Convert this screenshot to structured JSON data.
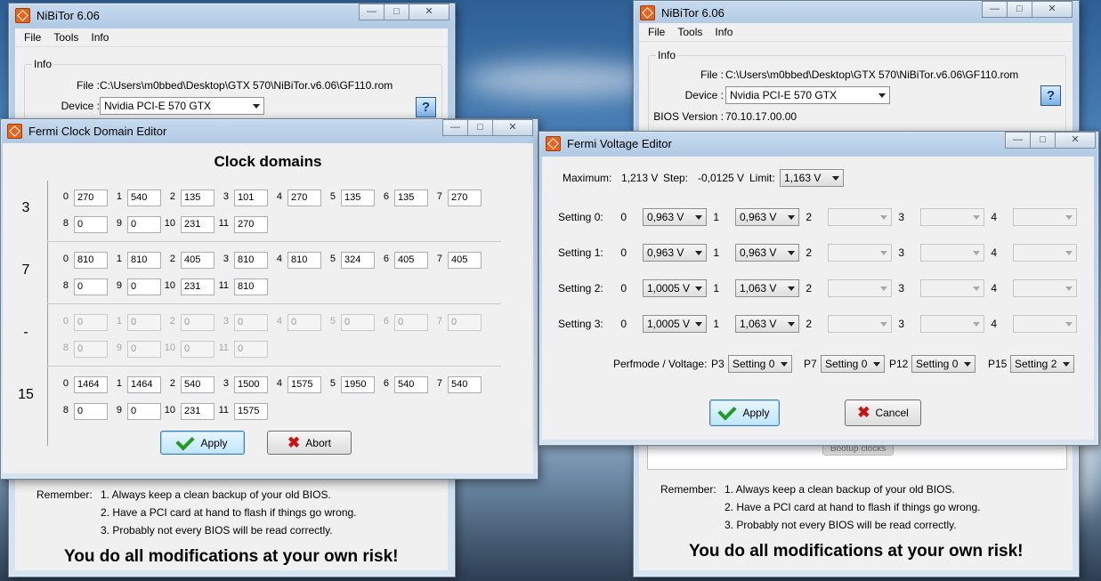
{
  "win1": {
    "title": "NiBiTor 6.06"
  },
  "win2": {
    "title": "NiBiTor 6.06"
  },
  "menu": [
    "File",
    "Tools",
    "Info"
  ],
  "info": {
    "group_title": "Info",
    "file_label": "File :",
    "file_path": "C:\\Users\\m0bbed\\Desktop\\GTX 570\\NiBiTor.v6.06\\GF110.rom",
    "device_label": "Device :",
    "device_value": "Nvidia PCI-E 570 GTX",
    "bios_label": "BIOS Version :",
    "bios_value": "70.10.17.00.00",
    "help_glyph": "?"
  },
  "remember": {
    "label": "Remember:",
    "items": [
      "1. Always keep a clean backup of your old BIOS.",
      "2. Have a PCI card at hand to flash if things go wrong.",
      "3. Probably not every BIOS will be read correctly."
    ],
    "risk": "You do all modifications at your own risk!"
  },
  "bootup_label": "Bootup clocks",
  "clock_editor": {
    "title": "Fermi Clock Domain Editor",
    "heading": "Clock domains",
    "rows": [
      {
        "label": "3",
        "disabled": false,
        "values": [
          "270",
          "540",
          "135",
          "101",
          "270",
          "135",
          "135",
          "270",
          "0",
          "0",
          "231",
          "270"
        ]
      },
      {
        "label": "7",
        "disabled": false,
        "values": [
          "810",
          "810",
          "405",
          "810",
          "810",
          "324",
          "405",
          "405",
          "0",
          "0",
          "231",
          "810"
        ]
      },
      {
        "label": "-",
        "disabled": true,
        "values": [
          "0",
          "0",
          "0",
          "0",
          "0",
          "0",
          "0",
          "0",
          "0",
          "0",
          "0",
          "0"
        ]
      },
      {
        "label": "15",
        "disabled": false,
        "values": [
          "1464",
          "1464",
          "540",
          "1500",
          "1575",
          "1950",
          "540",
          "540",
          "0",
          "0",
          "231",
          "1575"
        ]
      }
    ],
    "indices": [
      "0",
      "1",
      "2",
      "3",
      "4",
      "5",
      "6",
      "7",
      "8",
      "9",
      "10",
      "11"
    ],
    "apply_label": "Apply",
    "abort_label": "Abort"
  },
  "voltage_editor": {
    "title": "Fermi Voltage Editor",
    "maximum_label": "Maximum:",
    "maximum_value": "1,213 V",
    "step_label": "Step:",
    "step_value": "-0,0125 V",
    "limit_label": "Limit:",
    "limit_value": "1,163 V",
    "slot_indices": [
      "0",
      "1",
      "2",
      "3",
      "4"
    ],
    "settings": [
      {
        "label": "Setting 0:",
        "values": [
          "0,963 V",
          "0,963 V",
          "",
          "",
          ""
        ]
      },
      {
        "label": "Setting 1:",
        "values": [
          "0,963 V",
          "0,963 V",
          "",
          "",
          ""
        ]
      },
      {
        "label": "Setting 2:",
        "values": [
          "1,0005 V",
          "1,063 V",
          "",
          "",
          ""
        ]
      },
      {
        "label": "Setting 3:",
        "values": [
          "1,0005 V",
          "1,063 V",
          "",
          "",
          ""
        ]
      }
    ],
    "perfmode_label": "Perfmode / Voltage:",
    "perfmodes": [
      {
        "label": "P3",
        "value": "Setting 0"
      },
      {
        "label": "P7",
        "value": "Setting 0"
      },
      {
        "label": "P12",
        "value": "Setting 0"
      },
      {
        "label": "P15",
        "value": "Setting 2"
      }
    ],
    "apply_label": "Apply",
    "cancel_label": "Cancel"
  }
}
